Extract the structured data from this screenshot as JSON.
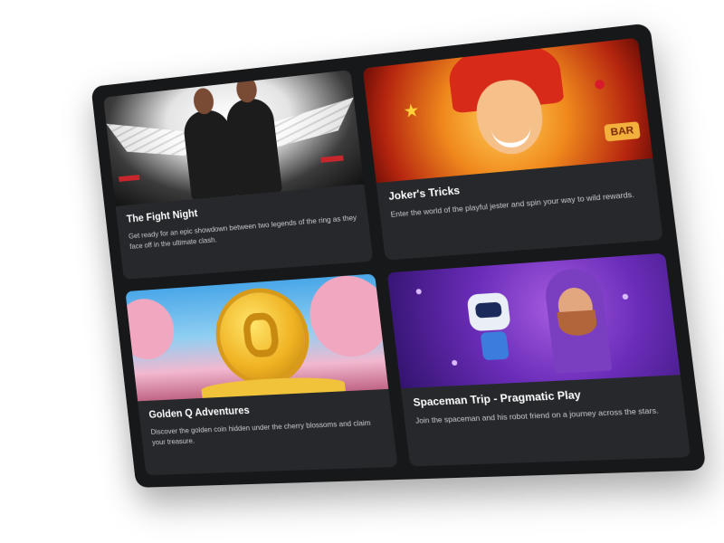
{
  "cards": [
    {
      "title": "The Fight Night",
      "description": "Get ready for an epic showdown between two legends of the ring as they face off in the ultimate clash."
    },
    {
      "title": "Joker's Tricks",
      "description": "Enter the world of the playful jester and spin your way to wild rewards."
    },
    {
      "title": "Golden Q Adventures",
      "description": "Discover the golden coin hidden under the cherry blossoms and claim your treasure."
    },
    {
      "title": "Spaceman Trip - Pragmatic Play",
      "description": "Join the spaceman and his robot friend on a journey across the stars."
    }
  ],
  "joker_badge": "BAR"
}
